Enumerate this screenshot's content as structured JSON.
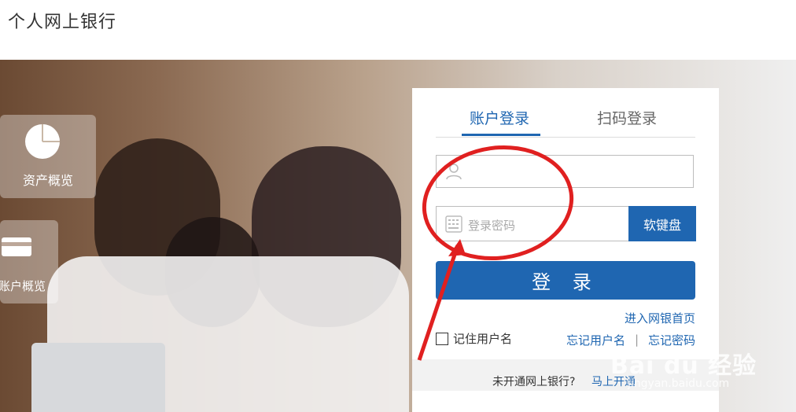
{
  "header": {
    "title": "个人网上银行"
  },
  "side_tiles": [
    {
      "label": "资产概览",
      "icon": "pie-chart-icon"
    },
    {
      "label": "账户概览",
      "icon": "card-icon"
    }
  ],
  "login": {
    "tabs": [
      {
        "label": "账户登录",
        "active": true
      },
      {
        "label": "扫码登录",
        "active": false
      }
    ],
    "username": {
      "placeholder": "",
      "value": ""
    },
    "password": {
      "placeholder": "登录密码"
    },
    "soft_keyboard_label": "软键盘",
    "login_button_label": "登 录",
    "home_link": "进入网银首页",
    "remember_label": "记住用户名",
    "forgot_username": "忘记用户名",
    "separator": "|",
    "forgot_password": "忘记密码",
    "footer_text": "未开通网上银行?",
    "footer_link": "马上开通"
  },
  "watermark": {
    "brand": "Bai du 经验",
    "url": "jingyan.baidu.com"
  },
  "colors": {
    "accent": "#1f66b1",
    "annotation_red": "#e02020"
  }
}
